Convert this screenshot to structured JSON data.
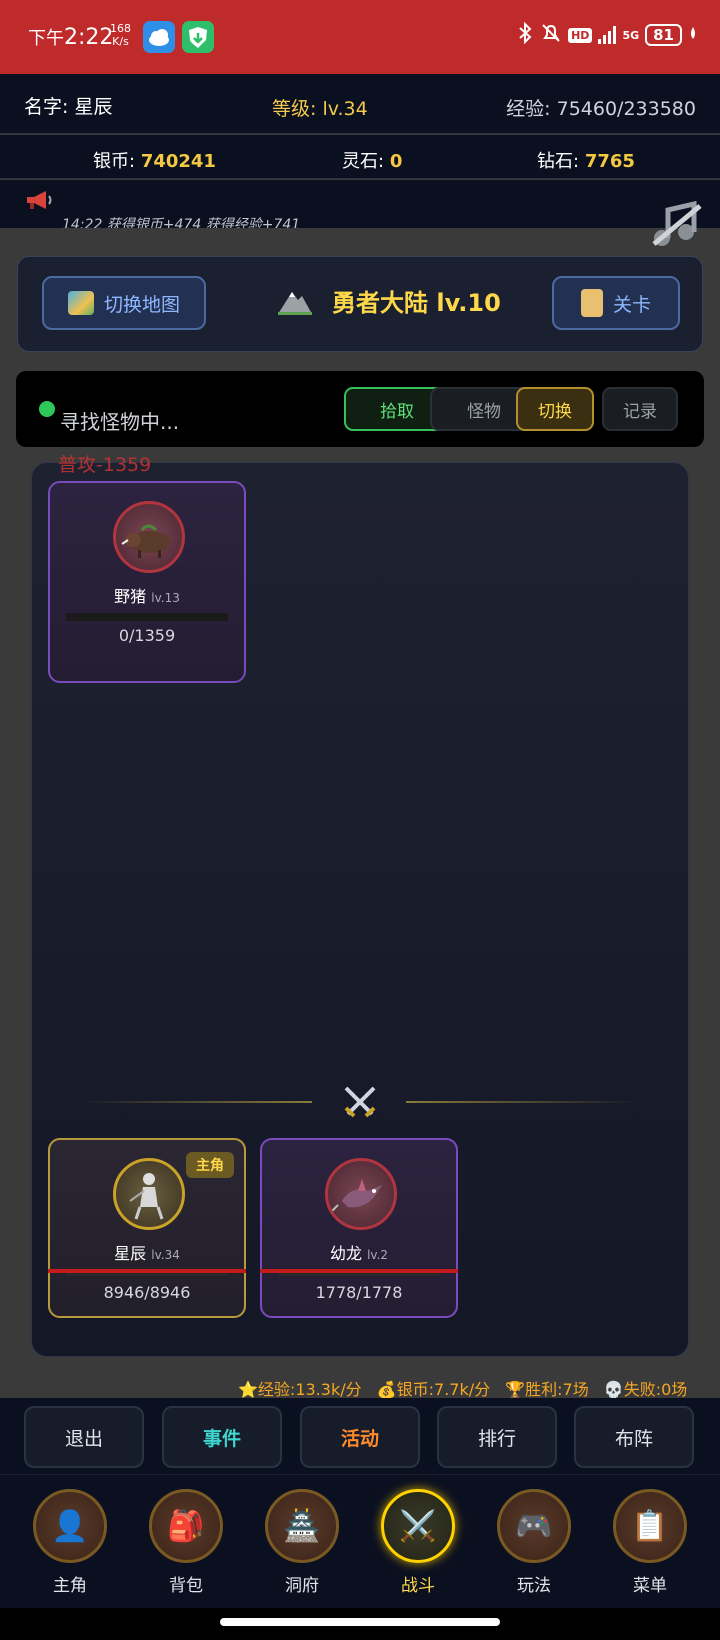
{
  "status_bar": {
    "time_prefix": "下午",
    "time": "2:22",
    "speed_value": "168",
    "speed_unit": "K/s",
    "hd": "HD",
    "signal": "5G",
    "battery": "81"
  },
  "player": {
    "name_label": "名字: 星辰",
    "level_label": "等级: lv.34",
    "exp_label": "经验: 75460/233580"
  },
  "currency": {
    "silver_label": "银币:",
    "silver_value": "740241",
    "spirit_label": "灵石:",
    "spirit_value": "0",
    "diamond_label": "钻石:",
    "diamond_value": "7765"
  },
  "notice": {
    "message": "14:22 获得银币+474 获得经验+741"
  },
  "map_panel": {
    "switch_map_label": "切换地图",
    "map_title": "勇者大陆 lv.10",
    "stage_label": "关卡"
  },
  "battle_status": {
    "status_text": "寻找怪物中...",
    "tabs": [
      "拾取",
      "怪物",
      "切换",
      "记录"
    ]
  },
  "attack_float": "普攻-1359",
  "enemies": [
    {
      "name": "野猪",
      "level": "lv.13",
      "hp": "0/1359",
      "hp_fraction": 0
    }
  ],
  "allies": [
    {
      "name": "星辰",
      "level": "lv.34",
      "hp": "8946/8946",
      "hp_fraction": 1,
      "badge": "主角"
    },
    {
      "name": "幼龙",
      "level": "lv.2",
      "hp": "1778/1778",
      "hp_fraction": 1
    }
  ],
  "stats": {
    "exp_rate": "⭐经验:13.3k/分",
    "silver_rate": "💰银币:7.7k/分",
    "wins": "🏆胜利:7场",
    "losses": "💀失败:0场"
  },
  "actions": {
    "exit": "退出",
    "events": "事件",
    "activities": "活动",
    "ranking": "排行",
    "formation": "布阵"
  },
  "nav": [
    {
      "label": "主角",
      "icon": "👤"
    },
    {
      "label": "背包",
      "icon": "🎒"
    },
    {
      "label": "洞府",
      "icon": "🏯"
    },
    {
      "label": "战斗",
      "icon": "⚔️"
    },
    {
      "label": "玩法",
      "icon": "🎮"
    },
    {
      "label": "菜单",
      "icon": "📋"
    }
  ],
  "colors": {
    "status_bar": "#bf2a2a",
    "accent_gold": "#ffd84a",
    "hp_red": "#c31b1b"
  }
}
